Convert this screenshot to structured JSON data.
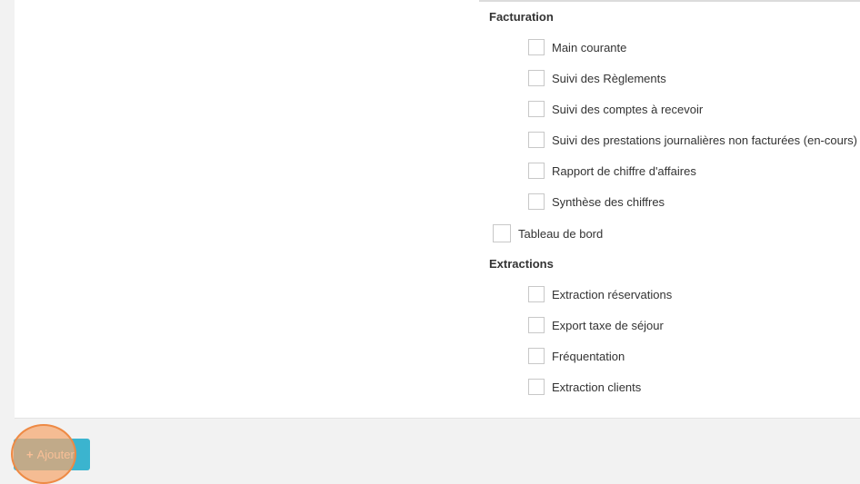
{
  "permissions": {
    "facturation": {
      "heading": "Facturation",
      "items": [
        {
          "label": "Main courante"
        },
        {
          "label": "Suivi des Règlements"
        },
        {
          "label": "Suivi des comptes à recevoir"
        },
        {
          "label": "Suivi des prestations journalières non facturées (en-cours)"
        },
        {
          "label": "Rapport de chiffre d'affaires"
        },
        {
          "label": "Synthèse des chiffres"
        }
      ]
    },
    "tableau_de_bord": {
      "label": "Tableau de bord"
    },
    "extractions": {
      "heading": "Extractions",
      "items": [
        {
          "label": "Extraction réservations"
        },
        {
          "label": "Export taxe de séjour"
        },
        {
          "label": "Fréquentation"
        },
        {
          "label": "Extraction clients"
        }
      ]
    }
  },
  "actions": {
    "add_label": "Ajouter",
    "add_icon": "plus-icon"
  },
  "colors": {
    "button": "#3bb4cf",
    "click_indicator": "#ee8a45"
  }
}
